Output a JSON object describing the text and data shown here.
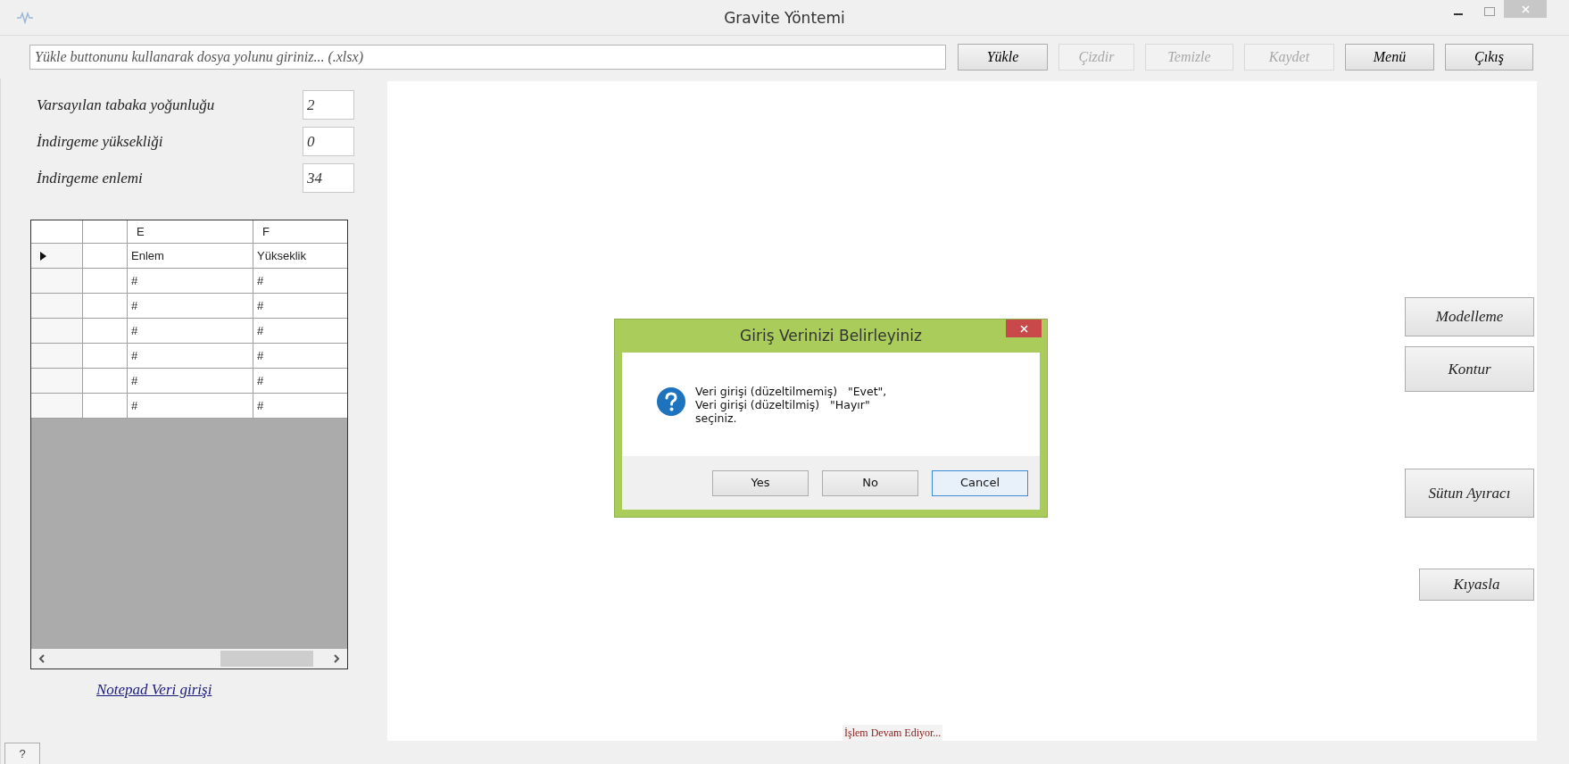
{
  "window": {
    "title": "Gravite Yöntemi"
  },
  "toolbar": {
    "path_field": {
      "placeholder": "Yükle buttonunu kullanarak dosya yolunu giriniz... (.xlsx)"
    },
    "buttons": [
      {
        "label": "Yükle",
        "disabled": false
      },
      {
        "label": "Çizdir",
        "disabled": true
      },
      {
        "label": "Temizle",
        "disabled": true
      },
      {
        "label": "Kaydet",
        "disabled": true
      },
      {
        "label": "Menü",
        "disabled": false
      },
      {
        "label": "Çıkış",
        "disabled": false
      }
    ]
  },
  "parameters": [
    {
      "label": "Varsayılan tabaka yoğunluğu",
      "value": "2"
    },
    {
      "label": "İndirgeme yüksekliği",
      "value": "0"
    },
    {
      "label": "İndirgeme enlemi",
      "value": "34"
    }
  ],
  "grid": {
    "columns": [
      "E",
      "F"
    ],
    "rows": [
      {
        "current": true,
        "cells": [
          "Enlem",
          "Yükseklik"
        ]
      },
      {
        "current": false,
        "cells": [
          "#",
          "#"
        ]
      },
      {
        "current": false,
        "cells": [
          "#",
          "#"
        ]
      },
      {
        "current": false,
        "cells": [
          "#",
          "#"
        ]
      },
      {
        "current": false,
        "cells": [
          "#",
          "#"
        ]
      },
      {
        "current": false,
        "cells": [
          "#",
          "#"
        ]
      },
      {
        "current": false,
        "cells": [
          "#",
          "#"
        ]
      }
    ]
  },
  "notepad_link": "Notepad Veri girişi",
  "help_button": "?",
  "side_buttons": [
    "Modelleme",
    "Kontur",
    "Sütun Ayıracı",
    "Kıyasla"
  ],
  "status_text": "İşlem Devam Ediyor...",
  "dialog": {
    "title": "Giriş Verinizi Belirleyiniz",
    "message_lines": [
      "Veri girişi (düzeltilmemiş)   \"Evet\",",
      "Veri girişi (düzeltilmiş)   \"Hayır\"",
      "seçiniz."
    ],
    "buttons": [
      {
        "label": "Yes",
        "default": false
      },
      {
        "label": "No",
        "default": false
      },
      {
        "label": "Cancel",
        "default": true
      }
    ]
  }
}
